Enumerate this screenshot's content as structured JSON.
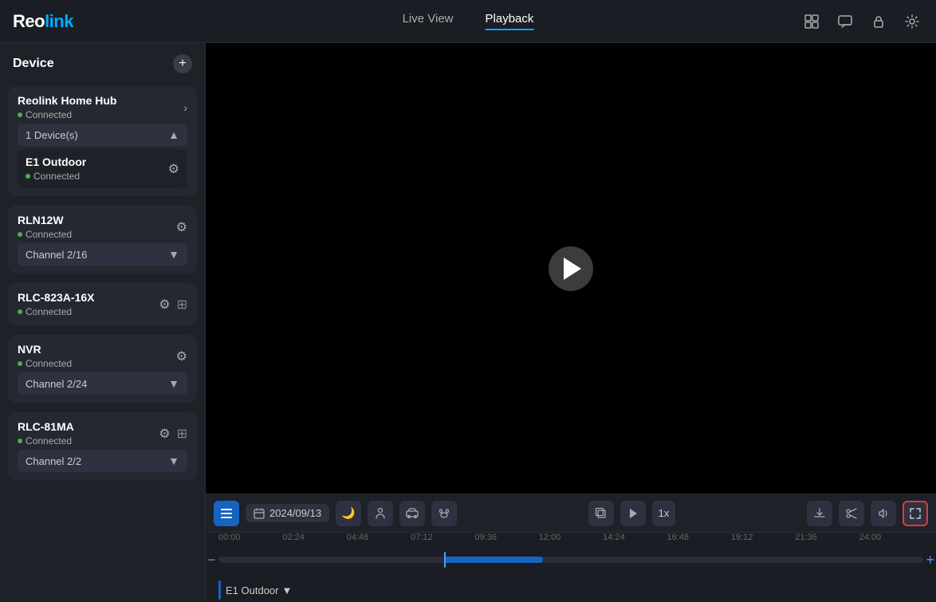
{
  "app": {
    "logo_reo": "Reo",
    "logo_link": "link"
  },
  "header": {
    "tab_live": "Live View",
    "tab_playback": "Playback",
    "icons": [
      "multiview-icon",
      "chat-icon",
      "lock-icon",
      "settings-icon"
    ]
  },
  "sidebar": {
    "title": "Device",
    "add_label": "+",
    "devices": [
      {
        "name": "Reolink Home Hub",
        "status": "Connected",
        "has_arrow": true,
        "has_gear": false,
        "sub_devices_label": "1 Device(s)",
        "sub_devices_expanded": true,
        "sub_devices": [
          {
            "name": "E1 Outdoor",
            "status": "Connected",
            "has_gear": true
          }
        ]
      },
      {
        "name": "RLN12W",
        "status": "Connected",
        "has_gear": true,
        "channel": "Channel 2/16",
        "channel_expanded": false
      },
      {
        "name": "RLC-823A-16X",
        "status": "Connected",
        "has_gear": true,
        "has_toggle": true
      },
      {
        "name": "NVR",
        "status": "Connected",
        "has_gear": true,
        "channel": "Channel 2/24",
        "channel_expanded": false
      },
      {
        "name": "RLC-81MA",
        "status": "Connected",
        "has_gear": true,
        "has_toggle": true,
        "channel": "Channel 2/2",
        "channel_expanded": false
      }
    ]
  },
  "video": {
    "play_button_label": "▶"
  },
  "controls": {
    "list_icon": "☰",
    "date": "2024/09/13",
    "calendar_icon": "📅",
    "filter_icons": [
      "moon-icon",
      "person-icon",
      "car-icon",
      "pet-icon"
    ],
    "copy_icon": "⧉",
    "play_icon": "▶",
    "speed": "1x",
    "download_icon": "⬇",
    "scissors_icon": "✂",
    "volume_icon": "🔊",
    "fullscreen_icon": "⛶"
  },
  "timeline": {
    "ticks": [
      "00:00",
      "02:24",
      "04:48",
      "07:12",
      "09:36",
      "12:00",
      "14:24",
      "16:48",
      "19:12",
      "21:36",
      "24:00"
    ],
    "segment_start_pct": 32,
    "segment_width_pct": 14,
    "cursor_pct": 32,
    "camera_label": "E1 Outdoor"
  }
}
